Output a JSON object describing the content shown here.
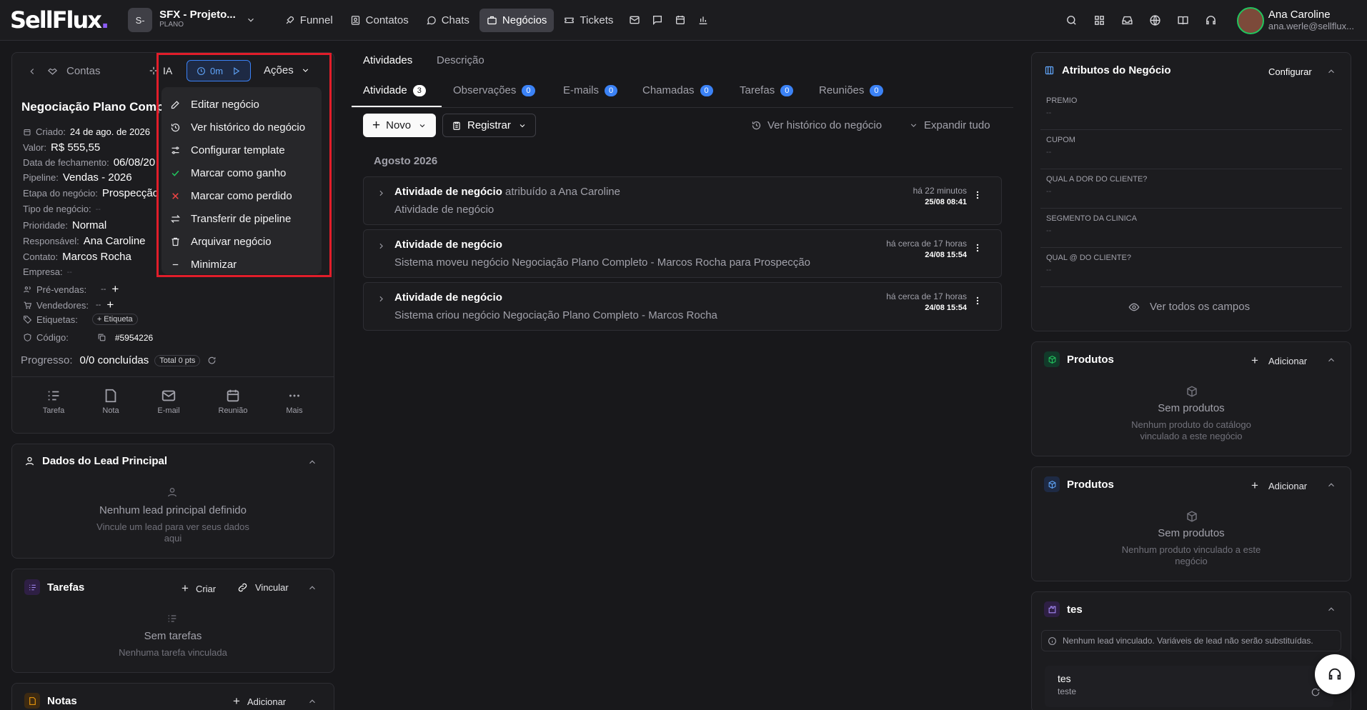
{
  "brand": {
    "logo": "SellFlux",
    "logo_dot": "."
  },
  "project": {
    "badge": "S-",
    "name": "SFX - Projeto...",
    "plan": "PLANO"
  },
  "nav": {
    "items": [
      {
        "label": "Funnel",
        "icon": "rocket-icon"
      },
      {
        "label": "Contatos",
        "icon": "contacts-icon"
      },
      {
        "label": "Chats",
        "icon": "chat-icon"
      },
      {
        "label": "Negócios",
        "icon": "briefcase-icon",
        "active": true
      },
      {
        "label": "Tickets",
        "icon": "ticket-icon"
      }
    ]
  },
  "user": {
    "name": "Ana Caroline",
    "email": "ana.werle@sellflux..."
  },
  "deal": {
    "back_label": "Contas",
    "ia_label": "IA",
    "timer": "0m",
    "actions_label": "Ações",
    "title": "Negociação Plano Comp",
    "fields": {
      "criado_label": "Criado:",
      "criado": "24 de ago. de 2026",
      "valor_label": "Valor:",
      "valor": "R$ 555,55",
      "fechamento_label": "Data de fechamento:",
      "fechamento": "06/08/20",
      "pipeline_label": "Pipeline:",
      "pipeline": "Vendas - 2026",
      "etapa_label": "Etapa do negócio:",
      "etapa": "Prospecção",
      "tipo_label": "Tipo de negócio:",
      "tipo": "--",
      "prioridade_label": "Prioridade:",
      "prioridade": "Normal",
      "responsavel_label": "Responsável:",
      "responsavel": "Ana Caroline",
      "contato_label": "Contato:",
      "contato": "Marcos Rocha",
      "empresa_label": "Empresa:",
      "empresa": "--",
      "prevendas_label": "Pré-vendas:",
      "prevendas": "--",
      "vendedores_label": "Vendedores:",
      "vendedores": "--",
      "etiquetas_label": "Etiquetas:",
      "etiqueta_btn": "+ Etiqueta",
      "codigo_label": "Código:",
      "codigo": "#5954226",
      "progresso_label": "Progresso:",
      "progresso": "0/0 concluídas",
      "pts": "Total 0 pts"
    },
    "quick_actions": [
      "Tarefa",
      "Nota",
      "E-mail",
      "Reunião",
      "Mais"
    ]
  },
  "menu": {
    "items": [
      "Editar negócio",
      "Ver histórico do negócio",
      "Configurar template",
      "Marcar como ganho",
      "Marcar como perdido",
      "Transferir de pipeline",
      "Arquivar negócio",
      "Minimizar"
    ]
  },
  "lead": {
    "title": "Dados do Lead Principal",
    "empty": "Nenhum lead principal definido",
    "hint": "Vincule um lead para ver seus dados aqui"
  },
  "tasks": {
    "title": "Tarefas",
    "create": "Criar",
    "link": "Vincular",
    "empty": "Sem tarefas",
    "hint": "Nenhuma tarefa vinculada"
  },
  "notes": {
    "title": "Notas",
    "add": "Adicionar"
  },
  "main": {
    "top_tabs": [
      "Atividades",
      "Descrição"
    ],
    "tabs": [
      {
        "label": "Atividade",
        "count": "3"
      },
      {
        "label": "Observações",
        "count": "0"
      },
      {
        "label": "E-mails",
        "count": "0"
      },
      {
        "label": "Chamadas",
        "count": "0"
      },
      {
        "label": "Tarefas",
        "count": "0"
      },
      {
        "label": "Reuniões",
        "count": "0"
      }
    ],
    "new_btn": "Novo",
    "register_btn": "Registrar",
    "history_link": "Ver histórico do negócio",
    "expand_link": "Expandir tudo",
    "month": "Agosto 2026",
    "activities": [
      {
        "title": "Atividade de negócio",
        "who": "atribuído a Ana Caroline",
        "desc": "Atividade de negócio",
        "rel": "há 22 minutos",
        "date": "25/08 08:41"
      },
      {
        "title": "Atividade de negócio",
        "who": "",
        "desc": "Sistema moveu negócio Negociação Plano Completo - Marcos Rocha para Prospecção",
        "rel": "há cerca de 17 horas",
        "date": "24/08 15:54"
      },
      {
        "title": "Atividade de negócio",
        "who": "",
        "desc": "Sistema criou negócio Negociação Plano Completo - Marcos Rocha",
        "rel": "há cerca de 17 horas",
        "date": "24/08 15:54"
      }
    ]
  },
  "attributes": {
    "title": "Atributos do Negócio",
    "configure": "Configurar",
    "fields": [
      {
        "label": "PREMIO",
        "value": "--"
      },
      {
        "label": "CUPOM",
        "value": "--"
      },
      {
        "label": "QUAL A DOR DO CLIENTE?",
        "value": "--"
      },
      {
        "label": "SEGMENTO DA CLINICA",
        "value": "--"
      },
      {
        "label": "QUAL @ DO CLIENTE?",
        "value": "--"
      }
    ],
    "see_all": "Ver todos os campos"
  },
  "products1": {
    "title": "Produtos",
    "add": "Adicionar",
    "empty": "Sem produtos",
    "hint": "Nenhum produto do catálogo vinculado a este negócio"
  },
  "products2": {
    "title": "Produtos",
    "add": "Adicionar",
    "empty": "Sem produtos",
    "hint": "Nenhum produto vinculado a este negócio"
  },
  "tes": {
    "title": "tes",
    "warning": "Nenhum lead vinculado. Variáveis de lead não serão substituídas.",
    "item_title": "tes",
    "item_sub": "teste"
  },
  "colors": {
    "accent": "#3b82f6",
    "danger": "#e11d2a",
    "success": "#22c55e",
    "brand": "#8b5cf6"
  }
}
